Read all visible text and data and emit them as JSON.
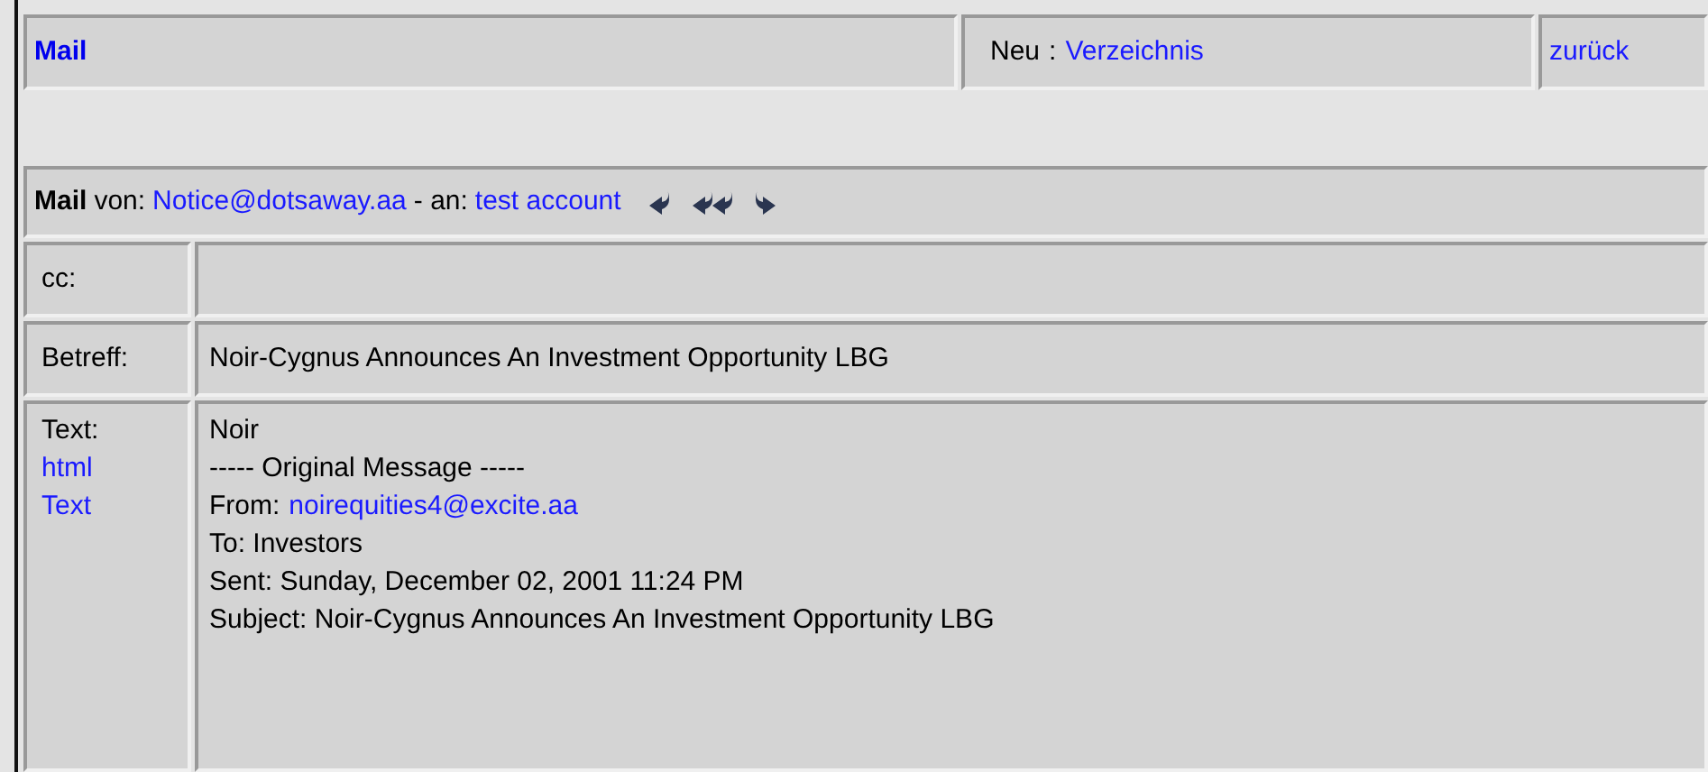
{
  "top_bar": {
    "title": "Mail",
    "new_label": "Neu",
    "separator": ":",
    "directory_link": "Verzeichnis",
    "back_link": "zurück"
  },
  "mail_header": {
    "title": "Mail",
    "from_label": "von:",
    "from": "Notice@dotsaway.aa",
    "to_label": "- an:",
    "to": "test account"
  },
  "fields": [
    {
      "label": "cc:"
    },
    {
      "label": "Betreff:",
      "value": "Noir-Cygnus Announces An Investment Opportunity LBG"
    }
  ],
  "body": {
    "label": "Text:",
    "format_links": [
      "html",
      "Text"
    ],
    "lines": [
      {
        "text": "Noir"
      },
      {
        "text": "----- Original Message -----"
      },
      {
        "text": "From:",
        "link": "noirequities4@excite.aa"
      },
      {
        "text": "To: Investors"
      },
      {
        "text": "Sent: Sunday, December 02, 2001 11:24 PM"
      },
      {
        "text": "Subject: Noir-Cygnus Announces An Investment Opportunity LBG"
      }
    ]
  }
}
